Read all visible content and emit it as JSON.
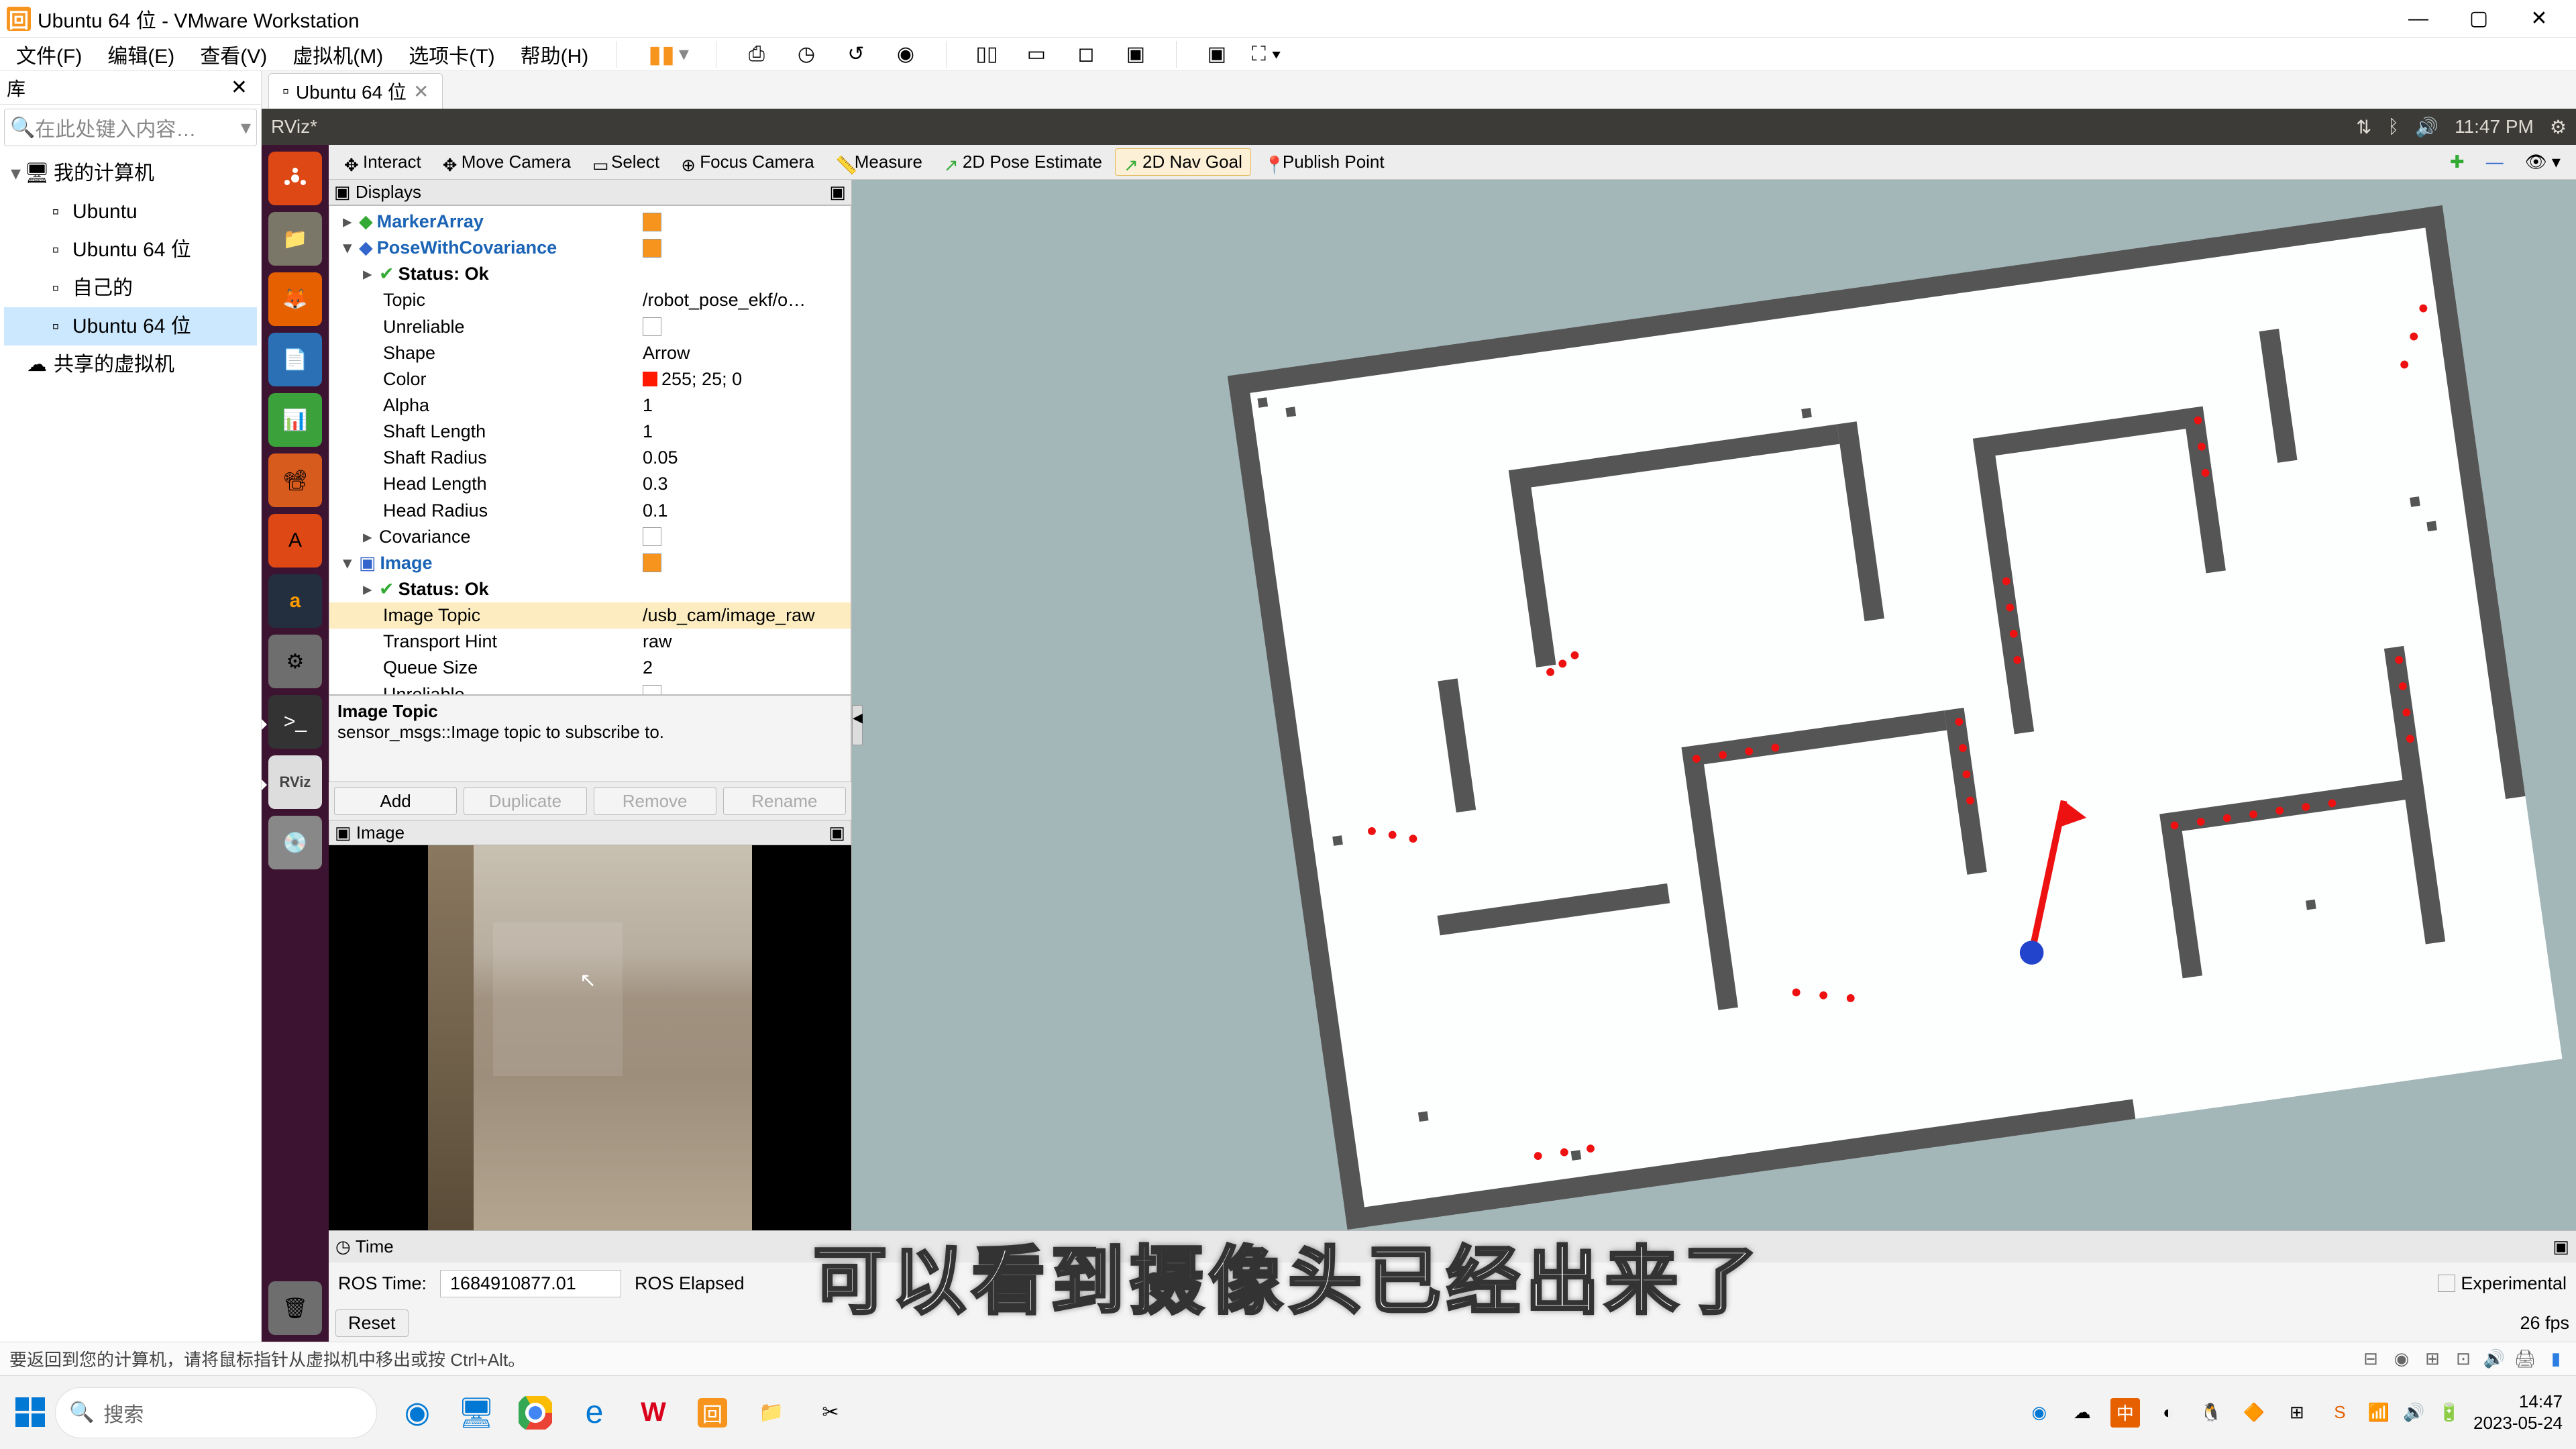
{
  "vmware": {
    "title": "Ubuntu 64 位 - VMware Workstation",
    "menu": [
      "文件(F)",
      "编辑(E)",
      "查看(V)",
      "虚拟机(M)",
      "选项卡(T)",
      "帮助(H)"
    ],
    "lib_title": "库",
    "search_placeholder": "在此处键入内容…",
    "tree": {
      "root": "我的计算机",
      "items": [
        "Ubuntu",
        "Ubuntu 64 位",
        "自己的",
        "Ubuntu 64 位"
      ],
      "shared": "共享的虚拟机"
    },
    "tab": "Ubuntu 64 位",
    "status": "要返回到您的计算机，请将鼠标指针从虚拟机中移出或按 Ctrl+Alt。"
  },
  "ubuntu": {
    "app_title": "RViz*",
    "clock": "11:47 PM"
  },
  "rviz": {
    "tools": {
      "interact": "Interact",
      "move": "Move Camera",
      "select": "Select",
      "focus": "Focus Camera",
      "measure": "Measure",
      "pose": "2D Pose Estimate",
      "nav": "2D Nav Goal",
      "publish": "Publish Point"
    },
    "displays_title": "Displays",
    "tree": {
      "marker": "MarkerArray",
      "pose": "PoseWithCovariance",
      "status": "Status: Ok",
      "topic_l": "Topic",
      "topic_v": "/robot_pose_ekf/o…",
      "unreliable": "Unreliable",
      "shape_l": "Shape",
      "shape_v": "Arrow",
      "color_l": "Color",
      "color_v": "255; 25; 0",
      "alpha_l": "Alpha",
      "alpha_v": "1",
      "shaftlen_l": "Shaft Length",
      "shaftlen_v": "1",
      "shaftrad_l": "Shaft Radius",
      "shaftrad_v": "0.05",
      "headlen_l": "Head Length",
      "headlen_v": "0.3",
      "headrad_l": "Head Radius",
      "headrad_v": "0.1",
      "covariance": "Covariance",
      "image": "Image",
      "img_topic_l": "Image Topic",
      "img_topic_v": "/usb_cam/image_raw",
      "transport_l": "Transport Hint",
      "transport_v": "raw",
      "queue_l": "Queue Size",
      "queue_v": "2"
    },
    "info_title": "Image Topic",
    "info_desc": "sensor_msgs::Image topic to subscribe to.",
    "btns": {
      "add": "Add",
      "dup": "Duplicate",
      "rem": "Remove",
      "ren": "Rename"
    },
    "image_title": "Image",
    "time_title": "Time",
    "ros_time_l": "ROS Time:",
    "ros_time_v": "1684910877.01",
    "ros_elapsed_l": "ROS Elapsed",
    "experimental": "Experimental",
    "reset": "Reset",
    "fps": "26 fps"
  },
  "subtitle": "可以看到摄像头已经出来了",
  "windows": {
    "search": "搜索",
    "time": "14:47",
    "date": "2023-05-24"
  }
}
